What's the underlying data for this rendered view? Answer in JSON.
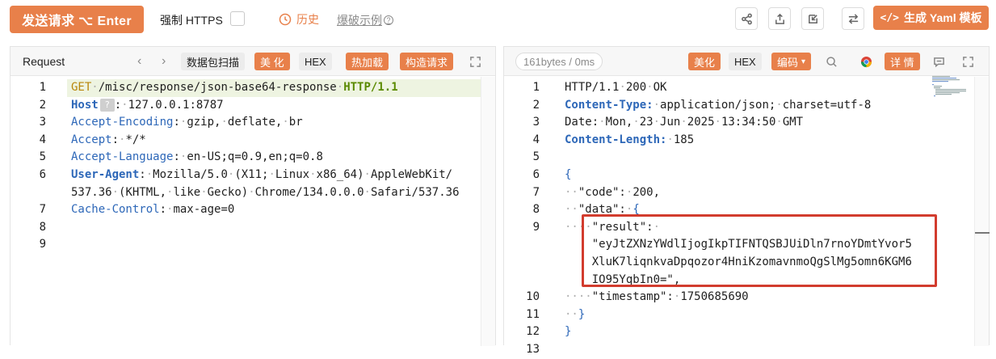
{
  "toolbar": {
    "send_label": "发送请求 ⌥ Enter",
    "force_https_label": "强制 HTTPS",
    "history_label": "历史",
    "brute_label": "爆破示例",
    "generate_yaml_label": "生成 Yaml 模板"
  },
  "request_panel": {
    "title": "Request",
    "buttons": [
      "数据包扫描",
      "美 化",
      "HEX",
      "热加载",
      "构造请求"
    ],
    "lines": [
      {
        "no": "1",
        "segments": [
          [
            "kw-method",
            "GET"
          ],
          [
            "dot",
            "·"
          ],
          [
            "kw-path",
            "/misc/response/json-base64-response"
          ],
          [
            "dot",
            "·"
          ],
          [
            "kw-proto",
            "HTTP/1.1"
          ]
        ]
      },
      {
        "no": "2",
        "segments": [
          [
            "kw-blue-b",
            "Host"
          ],
          [
            "qmark",
            "?"
          ],
          [
            "kw-path",
            ":"
          ],
          [
            "dot",
            "·"
          ],
          [
            "kw-path",
            "127.0.0.1:8787"
          ]
        ]
      },
      {
        "no": "3",
        "segments": [
          [
            "kw-blue",
            "Accept-Encoding"
          ],
          [
            "kw-path",
            ":"
          ],
          [
            "dot",
            "·"
          ],
          [
            "kw-path",
            "gzip,"
          ],
          [
            "dot",
            "·"
          ],
          [
            "kw-path",
            "deflate,"
          ],
          [
            "dot",
            "·"
          ],
          [
            "kw-path",
            "br"
          ]
        ]
      },
      {
        "no": "4",
        "segments": [
          [
            "kw-blue",
            "Accept"
          ],
          [
            "kw-path",
            ":"
          ],
          [
            "dot",
            "·"
          ],
          [
            "kw-path",
            "*/*"
          ]
        ]
      },
      {
        "no": "5",
        "segments": [
          [
            "kw-blue",
            "Accept-Language"
          ],
          [
            "kw-path",
            ":"
          ],
          [
            "dot",
            "·"
          ],
          [
            "kw-path",
            "en-US;q=0.9,en;q=0.8"
          ]
        ]
      },
      {
        "no": "6",
        "segments": [
          [
            "kw-blue-b",
            "User-Agent"
          ],
          [
            "kw-path",
            ":"
          ],
          [
            "dot",
            "·"
          ],
          [
            "kw-path",
            "Mozilla/5.0"
          ],
          [
            "dot",
            "·"
          ],
          [
            "kw-path",
            "(X11;"
          ],
          [
            "dot",
            "·"
          ],
          [
            "kw-path",
            "Linux"
          ],
          [
            "dot",
            "·"
          ],
          [
            "kw-path",
            "x86_64)"
          ],
          [
            "dot",
            "·"
          ],
          [
            "kw-path",
            "AppleWebKit/"
          ]
        ]
      },
      {
        "no": "",
        "segments": [
          [
            "kw-path",
            "537.36"
          ],
          [
            "dot",
            "·"
          ],
          [
            "kw-path",
            "(KHTML,"
          ],
          [
            "dot",
            "·"
          ],
          [
            "kw-path",
            "like"
          ],
          [
            "dot",
            "·"
          ],
          [
            "kw-path",
            "Gecko)"
          ],
          [
            "dot",
            "·"
          ],
          [
            "kw-path",
            "Chrome/134.0.0.0"
          ],
          [
            "dot",
            "·"
          ],
          [
            "kw-path",
            "Safari/537.36"
          ]
        ]
      },
      {
        "no": "7",
        "segments": [
          [
            "kw-blue",
            "Cache-Control"
          ],
          [
            "kw-path",
            ":"
          ],
          [
            "dot",
            "·"
          ],
          [
            "kw-path",
            "max-age=0"
          ]
        ]
      },
      {
        "no": "8",
        "segments": []
      },
      {
        "no": "9",
        "segments": []
      }
    ]
  },
  "response_panel": {
    "size_label": "161bytes / 0ms",
    "buttons": [
      "美化",
      "HEX",
      "编码",
      "详 情"
    ],
    "lines": [
      {
        "no": "1",
        "segments": [
          [
            "kw-path",
            "HTTP/1.1"
          ],
          [
            "dot",
            "·"
          ],
          [
            "kw-path",
            "200"
          ],
          [
            "dot",
            "·"
          ],
          [
            "kw-path",
            "OK"
          ]
        ]
      },
      {
        "no": "2",
        "segments": [
          [
            "kw-blue-b",
            "Content-Type:"
          ],
          [
            "dot",
            "·"
          ],
          [
            "kw-path",
            "application/json;"
          ],
          [
            "dot",
            "·"
          ],
          [
            "kw-path",
            "charset=utf-8"
          ]
        ]
      },
      {
        "no": "3",
        "segments": [
          [
            "kw-path",
            "Date:"
          ],
          [
            "dot",
            "·"
          ],
          [
            "kw-path",
            "Mon,"
          ],
          [
            "dot",
            "·"
          ],
          [
            "kw-path",
            "23"
          ],
          [
            "dot",
            "·"
          ],
          [
            "kw-path",
            "Jun"
          ],
          [
            "dot",
            "·"
          ],
          [
            "kw-path",
            "2025"
          ],
          [
            "dot",
            "·"
          ],
          [
            "kw-path",
            "13:34:50"
          ],
          [
            "dot",
            "·"
          ],
          [
            "kw-path",
            "GMT"
          ]
        ]
      },
      {
        "no": "4",
        "segments": [
          [
            "kw-blue-b",
            "Content-Length:"
          ],
          [
            "dot",
            "·"
          ],
          [
            "kw-path",
            "185"
          ]
        ]
      },
      {
        "no": "5",
        "segments": []
      },
      {
        "no": "6",
        "segments": [
          [
            "kw-blue",
            "{"
          ]
        ]
      },
      {
        "no": "7",
        "segments": [
          [
            "dot",
            "··"
          ],
          [
            "kw-path",
            "\"code\":"
          ],
          [
            "dot",
            "·"
          ],
          [
            "kw-path",
            "200,"
          ]
        ]
      },
      {
        "no": "8",
        "segments": [
          [
            "dot",
            "··"
          ],
          [
            "kw-path",
            "\"data\":"
          ],
          [
            "dot",
            "·"
          ],
          [
            "kw-blue",
            "{"
          ]
        ]
      },
      {
        "no": "9",
        "segments": [
          [
            "dot",
            "··"
          ],
          [
            "dot",
            "··"
          ],
          [
            "kw-path",
            "\"result\":"
          ],
          [
            "dot",
            "·"
          ]
        ]
      },
      {
        "no": "",
        "segments": [
          [
            "dot",
            "    "
          ],
          [
            "kw-path",
            "\"eyJtZXNzYWdlIjogIkpTIFNTQSBJUiDln7rnoYDmtYvor5"
          ]
        ]
      },
      {
        "no": "",
        "segments": [
          [
            "dot",
            "    "
          ],
          [
            "kw-path",
            "XluK7liqnkvaDpqozor4HniKzomavnmoQgSlMg5omn6KGM6"
          ]
        ]
      },
      {
        "no": "",
        "segments": [
          [
            "dot",
            "    "
          ],
          [
            "kw-path",
            "IO95YqbIn0=\","
          ]
        ]
      },
      {
        "no": "10",
        "segments": [
          [
            "dot",
            "··"
          ],
          [
            "dot",
            "··"
          ],
          [
            "kw-path",
            "\"timestamp\":"
          ],
          [
            "dot",
            "·"
          ],
          [
            "kw-path",
            "1750685690"
          ]
        ]
      },
      {
        "no": "11",
        "segments": [
          [
            "dot",
            "··"
          ],
          [
            "kw-blue",
            "}"
          ]
        ]
      },
      {
        "no": "12",
        "segments": [
          [
            "kw-blue",
            "}"
          ]
        ]
      },
      {
        "no": "13",
        "segments": []
      }
    ]
  }
}
